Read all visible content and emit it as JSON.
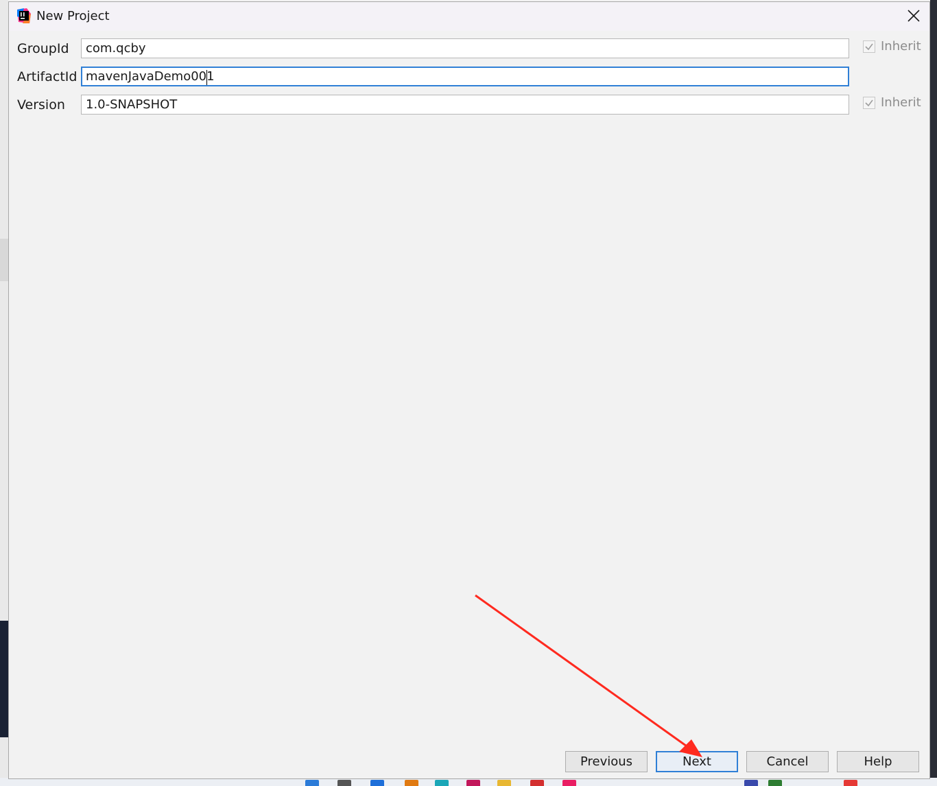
{
  "dialog": {
    "title": "New Project",
    "icon": "intellij-idea-icon",
    "close_icon": "close-icon"
  },
  "fields": {
    "group_id": {
      "label": "GroupId",
      "value": "com.qcby",
      "inherit_label": "Inherit",
      "inherit_checked": true
    },
    "artifact_id": {
      "label": "ArtifactId",
      "value": "mavenJavaDemo001",
      "focused": true
    },
    "version": {
      "label": "Version",
      "value": "1.0-SNAPSHOT",
      "inherit_label": "Inherit",
      "inherit_checked": true
    }
  },
  "buttons": {
    "previous": "Previous",
    "next": "Next",
    "cancel": "Cancel",
    "help": "Help"
  },
  "annotation": {
    "type": "red-arrow",
    "points_to": "next-button",
    "color": "#ff2a1f"
  },
  "colors": {
    "focus_border": "#2f7fd6",
    "dialog_bg": "#f2f2f2",
    "titlebar_bg": "#f4f2f7"
  }
}
